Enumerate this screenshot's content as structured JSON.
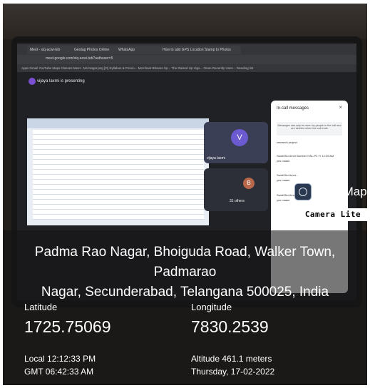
{
  "screen": {
    "tabs": [
      "Meet - xiq-acwi-teb",
      "Geotag Photos Online",
      "WhatsApp",
      "How to add GPS Location Stamp to Photos"
    ],
    "url": "meet.google.com/xiq-acwi-teb?authuser=5",
    "bookmarks": "Apps  Gmail  YouTube  Maps  Classes  Meet - Ms Nagar.png  [O] Syllabus & Previo...  Merchant Bhaves Sp... The Raised Up Vigo... Onan Recently Uses...  Reading list",
    "presenter_text": "vijaya laxmi is presenting",
    "tile_v": {
      "initial": "V",
      "label": "vijaya laxmi"
    },
    "tile_b": {
      "initial": "B",
      "label": "31 others"
    },
    "panel": {
      "title": "In-call messages",
      "close": "×",
      "note": "Messages can only be seen by people in the call and are deleted when the call ends",
      "messages": [
        "research project",
        "Swati Bio Amer Bomber HAL-P3 YI  12:39 AM",
        "yes maam",
        "Swati Bio Amer...",
        "yes maam",
        "Swati Bio Amer Bo...",
        "yes maam"
      ]
    }
  },
  "watermark": {
    "title": "GPS Map",
    "subtitle": "Camera Lite",
    "icon": "camera-lens-icon"
  },
  "stamp": {
    "address_line1": "Padma Rao Nagar, Bhoiguda Road, Walker Town, Padmarao",
    "address_line2": "Nagar, Secunderabad, Telangana 500025, India",
    "latitude_label": "Latitude",
    "latitude_value": "1725.75069",
    "longitude_label": "Longitude",
    "longitude_value": "7830.2539",
    "local_time": "Local 12:12:33 PM",
    "gmt_time": "GMT 06:42:33 AM",
    "altitude": "Altitude 461.1 meters",
    "date": "Thursday, 17-02-2022"
  }
}
